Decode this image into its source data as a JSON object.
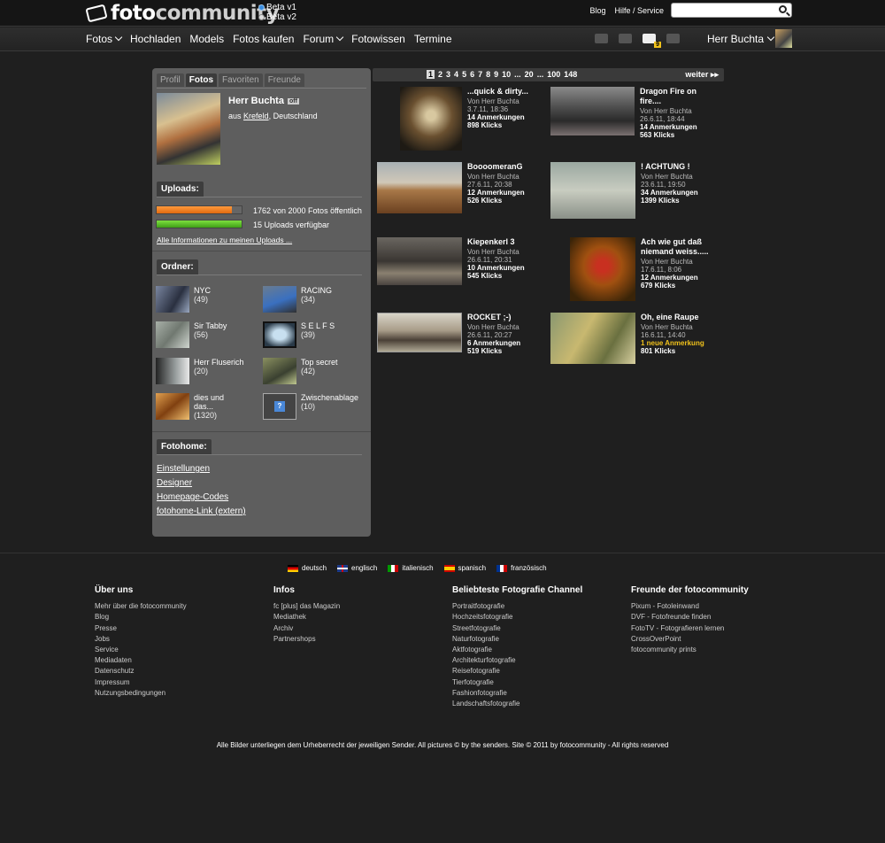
{
  "brand": {
    "name_a": "foto",
    "name_b": "community",
    "beta_v1": "Beta v1",
    "beta_v2": "Beta v2"
  },
  "top_links": {
    "blog": "Blog",
    "help": "Hilfe / Service"
  },
  "search": {
    "placeholder": ""
  },
  "nav": {
    "items": [
      "Fotos",
      "Hochladen",
      "Models",
      "Fotos kaufen",
      "Forum",
      "Fotowissen",
      "Termine"
    ],
    "messages_badge": "9",
    "user": "Herr Buchta"
  },
  "sidebar": {
    "tabs": [
      "Profil",
      "Fotos",
      "Favoriten",
      "Freunde"
    ],
    "profile": {
      "name": "Herr Buchta",
      "status": "off",
      "from": "aus",
      "city": "Krefeld",
      "country": ", Deutschland"
    },
    "uploads": {
      "label": "Uploads:",
      "photos_text": "1762 von 2000 Fotos öffentlich",
      "photos_progress": 0.881,
      "uploads_text": "15 Uploads verfügbar",
      "uploads_progress": 1.0,
      "all_info": "Alle Informationen zu meinen Uploads ..."
    },
    "folders_label": "Ordner:",
    "folders": [
      {
        "name": "NYC",
        "count": "(49)"
      },
      {
        "name": "RACING",
        "count": "(34)"
      },
      {
        "name": "Sir Tabby",
        "count": "(56)"
      },
      {
        "name": "S E L F S",
        "count": "(39)"
      },
      {
        "name": "Herr Fluserich",
        "count": "(20)"
      },
      {
        "name": "Top secret",
        "count": "(42)"
      },
      {
        "name": "dies und das...",
        "count": "(1320)"
      },
      {
        "name": "Zwischenablage",
        "count": "(10)"
      }
    ],
    "fotohome": {
      "label": "Fotohome:",
      "links": [
        "Einstellungen",
        "Designer",
        "Homepage-Codes",
        "fotohome-Link (extern)"
      ]
    }
  },
  "pager": {
    "pages": [
      "1",
      "2",
      "3",
      "4",
      "5",
      "6",
      "7",
      "8",
      "9",
      "10",
      "...",
      "20",
      "...",
      "100",
      "148"
    ],
    "next": "weiter"
  },
  "photos": [
    {
      "title": "...quick & dirty...",
      "by": "Von Herr Buchta",
      "date": "3.7.11, 18:36",
      "notes": "14 Anmerkungen",
      "clicks": "898 Klicks"
    },
    {
      "title": "Dragon Fire on fire....",
      "by": "Von Herr Buchta",
      "date": "26.6.11, 18:44",
      "notes": "14 Anmerkungen",
      "clicks": "563 Klicks"
    },
    {
      "title": "BoooomeranG",
      "by": "Von Herr Buchta",
      "date": "27.6.11, 20:38",
      "notes": "12 Anmerkungen",
      "clicks": "526 Klicks"
    },
    {
      "title": "! ACHTUNG !",
      "by": "Von Herr Buchta",
      "date": "23.6.11, 19:50",
      "notes": "34 Anmerkungen",
      "clicks": "1399 Klicks"
    },
    {
      "title": "Kiepenkerl 3",
      "by": "Von Herr Buchta",
      "date": "26.6.11, 20:31",
      "notes": "10 Anmerkungen",
      "clicks": "545 Klicks"
    },
    {
      "title": "Ach wie gut daß niemand weiss.....",
      "by": "Von Herr Buchta",
      "date": "17.6.11, 8:06",
      "notes": "12 Anmerkungen",
      "clicks": "679 Klicks"
    },
    {
      "title": "ROCKET ;-)",
      "by": "Von Herr Buchta",
      "date": "26.6.11, 20:27",
      "notes": "6 Anmerkungen",
      "clicks": "519 Klicks"
    },
    {
      "title": "Oh, eine Raupe",
      "by": "Von Herr Buchta",
      "date": "16.6.11, 14:40",
      "notes": "1 neue Anmerkung",
      "clicks": "801 Klicks"
    }
  ],
  "languages": [
    "deutsch",
    "englisch",
    "italienisch",
    "spanisch",
    "französisch"
  ],
  "footer": {
    "columns": [
      {
        "heading": "Über uns",
        "links": [
          "Mehr über die fotocommunity",
          "Blog",
          "Presse",
          "Jobs",
          "Service",
          "Mediadaten",
          "Datenschutz",
          "Impressum",
          "Nutzungsbedingungen"
        ]
      },
      {
        "heading": "Infos",
        "links": [
          "fc [plus] das Magazin",
          "Mediathek",
          "Archiv",
          "Partnershops"
        ]
      },
      {
        "heading": "Beliebteste Fotografie Channel",
        "links": [
          "Portraitfotografie",
          "Hochzeitsfotografie",
          "Streetfotografie",
          "Naturfotografie",
          "Aktfotografie",
          "Architekturfotografie",
          "Reisefotografie",
          "Tierfotografie",
          "Fashionfotografie",
          "Landschaftsfotografie"
        ]
      },
      {
        "heading": "Freunde der fotocommunity",
        "links": [
          "Pixum - Fotoleinwand",
          "DVF - Fotofreunde finden",
          "FotoTV - Fotografieren lernen",
          "CrossOverPoint",
          "fotocommunity prints"
        ]
      }
    ],
    "copyright": "Alle Bilder unterliegen dem Urheberrecht der jeweiligen Sender. All pictures © by the senders. Site © 2011 by fotocommunity - All rights reserved"
  }
}
